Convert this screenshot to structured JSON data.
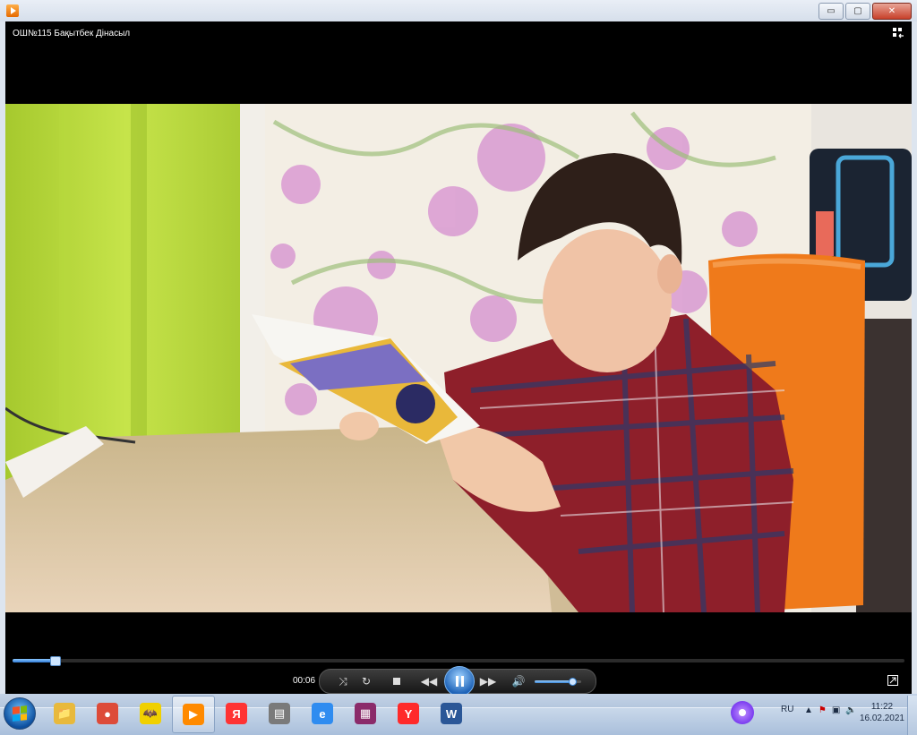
{
  "window": {
    "controls": {
      "minimize": "▭",
      "maximize": "▢",
      "close": "✕"
    }
  },
  "player": {
    "media_title": "ОШ№115  Бақытбек Дінасыл",
    "current_time": "00:06",
    "seek_progress": 0.047,
    "volume_level": 0.8,
    "state": "playing"
  },
  "taskbar": {
    "items": [
      {
        "name": "explorer-icon",
        "color": "#e8b93c",
        "glyph": "📁"
      },
      {
        "name": "chrome-icon",
        "color": "#dd4b39",
        "glyph": "●"
      },
      {
        "name": "batman-app-icon",
        "color": "#f0d000",
        "glyph": "🦇"
      },
      {
        "name": "media-player-icon",
        "color": "#ff8a00",
        "glyph": "▶",
        "active": true
      },
      {
        "name": "yandex-icon",
        "color": "#ff3333",
        "glyph": "Я"
      },
      {
        "name": "scanner-app-icon",
        "color": "#7a7a7a",
        "glyph": "▤"
      },
      {
        "name": "internet-explorer-icon",
        "color": "#2f8cf0",
        "glyph": "e"
      },
      {
        "name": "winrar-icon",
        "color": "#8b2b6a",
        "glyph": "▦"
      },
      {
        "name": "yandex-browser-icon",
        "color": "#ff2a2a",
        "glyph": "Y"
      },
      {
        "name": "word-icon",
        "color": "#2b5797",
        "glyph": "W"
      }
    ],
    "tray": {
      "language": "RU",
      "time": "11:22",
      "date": "16.02.2021"
    }
  }
}
